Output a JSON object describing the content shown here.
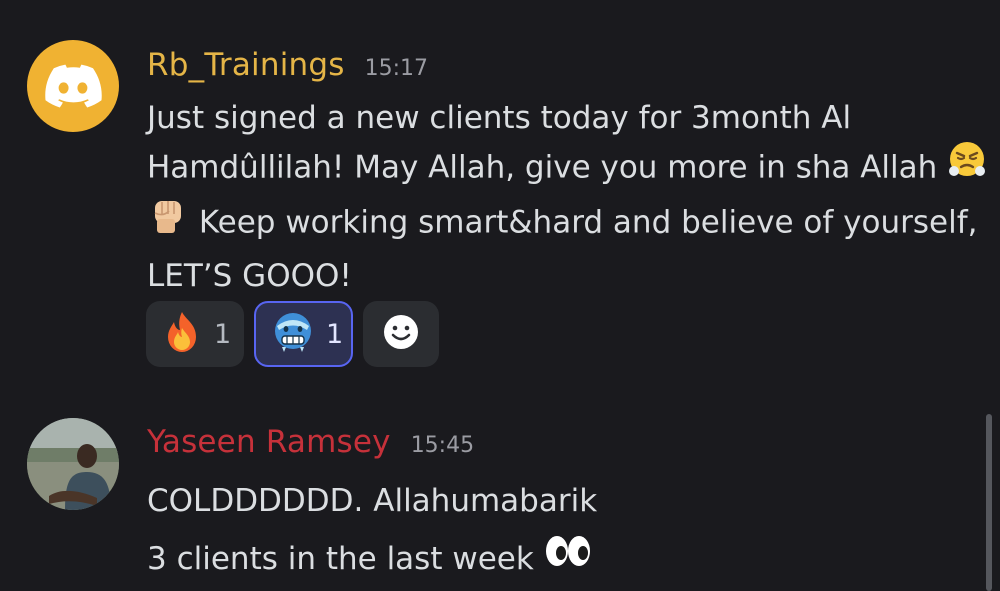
{
  "messages": [
    {
      "username": "Rb_Trainings",
      "timestamp": "15:17",
      "avatar": "discord-logo-icon",
      "lines": [
        "Just signed a new clients today for 3month Al",
        "Hamdûllilah! May Allah, give you more in sha Allah",
        "Keep working smart&hard  and believe of yourself,",
        "LET’S GOOO!"
      ],
      "reactions": [
        {
          "emoji": "🔥",
          "icon": "fire-emoji-icon",
          "count": "1",
          "selected": false
        },
        {
          "emoji": "🥶",
          "icon": "cold-face-emoji-icon",
          "count": "1",
          "selected": true
        }
      ],
      "add_reaction_icon": "smiley-add-reaction-icon"
    },
    {
      "username": "Yaseen Ramsey",
      "timestamp": "15:45",
      "avatar": "user-photo-avatar",
      "lines": [
        "COLDDDDDD. Allahumabarik",
        "3 clients in the last week"
      ]
    }
  ],
  "colors": {
    "background": "#1a1a1e",
    "username_1": "#e5b547",
    "username_2": "#c6313a",
    "selected_reaction_border": "#5865f2"
  }
}
